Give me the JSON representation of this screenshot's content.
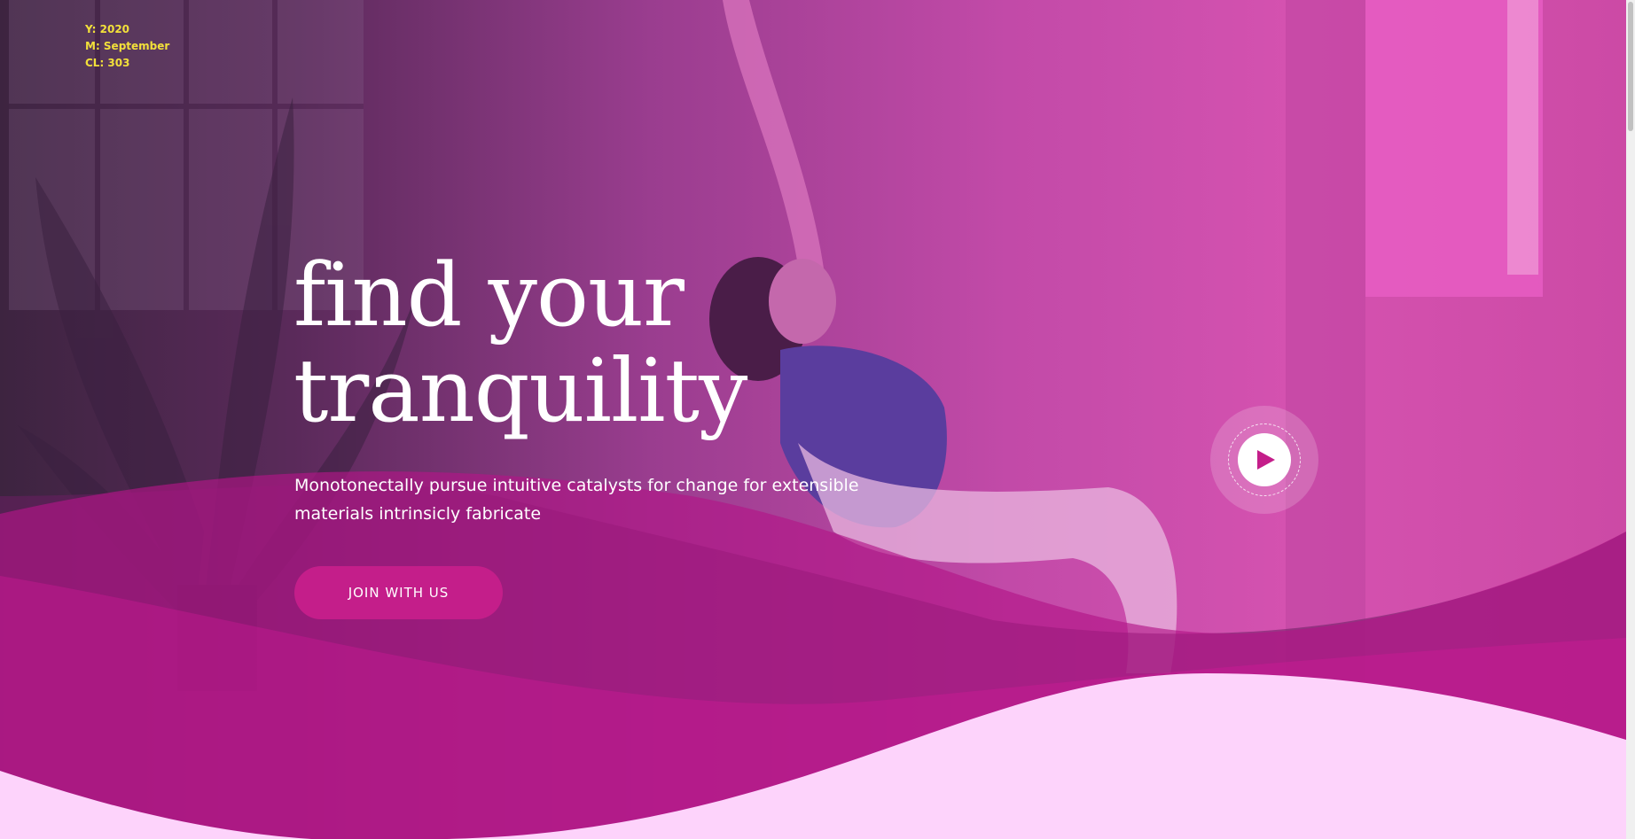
{
  "debug": {
    "year": "Y: 2020",
    "month": "M: September",
    "cl": "CL: 303"
  },
  "hero": {
    "title_line1": "find your",
    "title_line2": "tranquility",
    "subtitle": "Monotonectally pursue intuitive catalysts for change for extensible materials intrinsicly fabricate",
    "cta_label": "JOIN WITH US"
  },
  "icons": {
    "play": "play-icon"
  },
  "colors": {
    "accent": "#c41e8a",
    "wave_light": "#fdd3fb",
    "wave_mid": "#d81a9a",
    "overlay_text": "#f2e03a"
  }
}
